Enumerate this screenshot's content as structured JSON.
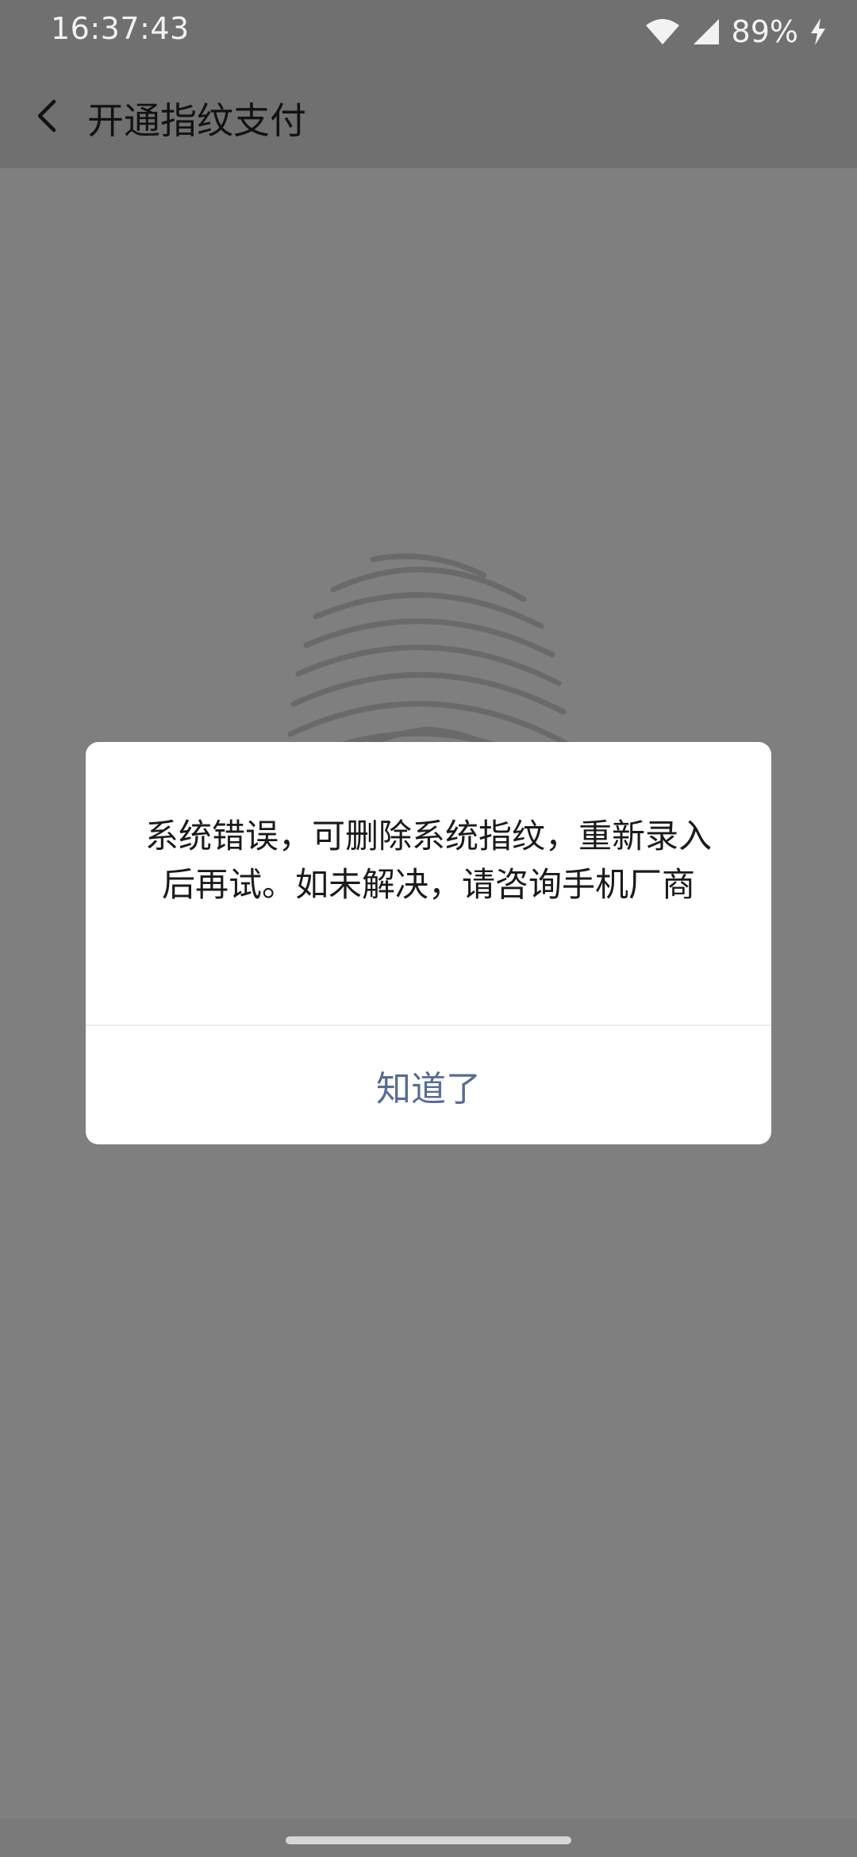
{
  "status_bar": {
    "time": "16:37:43",
    "battery": "89%",
    "icons": [
      "wifi-icon",
      "signal-icon",
      "charging-icon"
    ]
  },
  "nav": {
    "back_icon": "back-arrow-icon",
    "title": "开通指纹支付"
  },
  "content": {
    "icon": "fingerprint-icon"
  },
  "dialog": {
    "message": "系统错误，可删除系统指纹，重新录入后再试。如未解决，请咨询手机厂商",
    "confirm_label": "知道了",
    "accent_color": "#576b95"
  },
  "colors": {
    "overlay_bg": "#7f7f7f",
    "bar_bg": "#707070"
  }
}
